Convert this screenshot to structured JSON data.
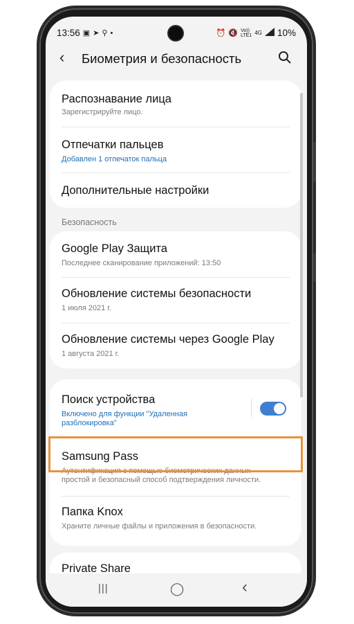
{
  "status_bar": {
    "time": "13:56",
    "left_icons": [
      "image-icon",
      "location-icon",
      "search-icon",
      "dot-icon"
    ],
    "right_icons": [
      "alarm-icon",
      "mute-icon",
      "volte-icon",
      "4g-icon",
      "signal-icon"
    ],
    "network_label_top": "Vo))",
    "network_label_bottom": "LTE1",
    "network_type": "4G",
    "battery": "10%"
  },
  "app_bar": {
    "title": "Биометрия и безопасность"
  },
  "biometrics": [
    {
      "title": "Распознавание лица",
      "subtitle": "Зарегистрируйте лицо."
    },
    {
      "title": "Отпечатки пальцев",
      "subtitle": "Добавлен 1 отпечаток пальца",
      "subtitle_color": "#1d6fb8"
    },
    {
      "title": "Дополнительные настройки"
    }
  ],
  "security_section": {
    "label": "Безопасность",
    "items": [
      {
        "title": "Google Play Защита",
        "subtitle": "Последнее сканирование приложений: 13:50"
      },
      {
        "title": "Обновление системы безопасности",
        "subtitle": "1 июля 2021 г."
      },
      {
        "title": "Обновление системы через Google Play",
        "subtitle": "1 августа 2021 г."
      }
    ]
  },
  "device_section": {
    "find_device": {
      "title": "Поиск устройства",
      "subtitle_line1": "Включено для функции \"Удаленная",
      "subtitle_line2": "разблокировка\"",
      "toggle_on": true
    },
    "samsung_pass": {
      "title": "Samsung Pass",
      "subtitle_line1": "Аутентификация с помощью биометрических данных —",
      "subtitle_line2": "простой и безопасный способ подтверждения личности.",
      "highlight_color": "#e6923e"
    },
    "knox": {
      "title": "Папка Knox",
      "subtitle": "Храните личные файлы и приложения в безопасности."
    }
  },
  "partial_item": {
    "title": "Private Share"
  },
  "nav_bar": {
    "recents": "|||",
    "home": "◯",
    "back": "‹"
  },
  "colors": {
    "accent": "#1d6fb8",
    "toggle": "#3e7fd1",
    "highlight": "#e6923e"
  }
}
